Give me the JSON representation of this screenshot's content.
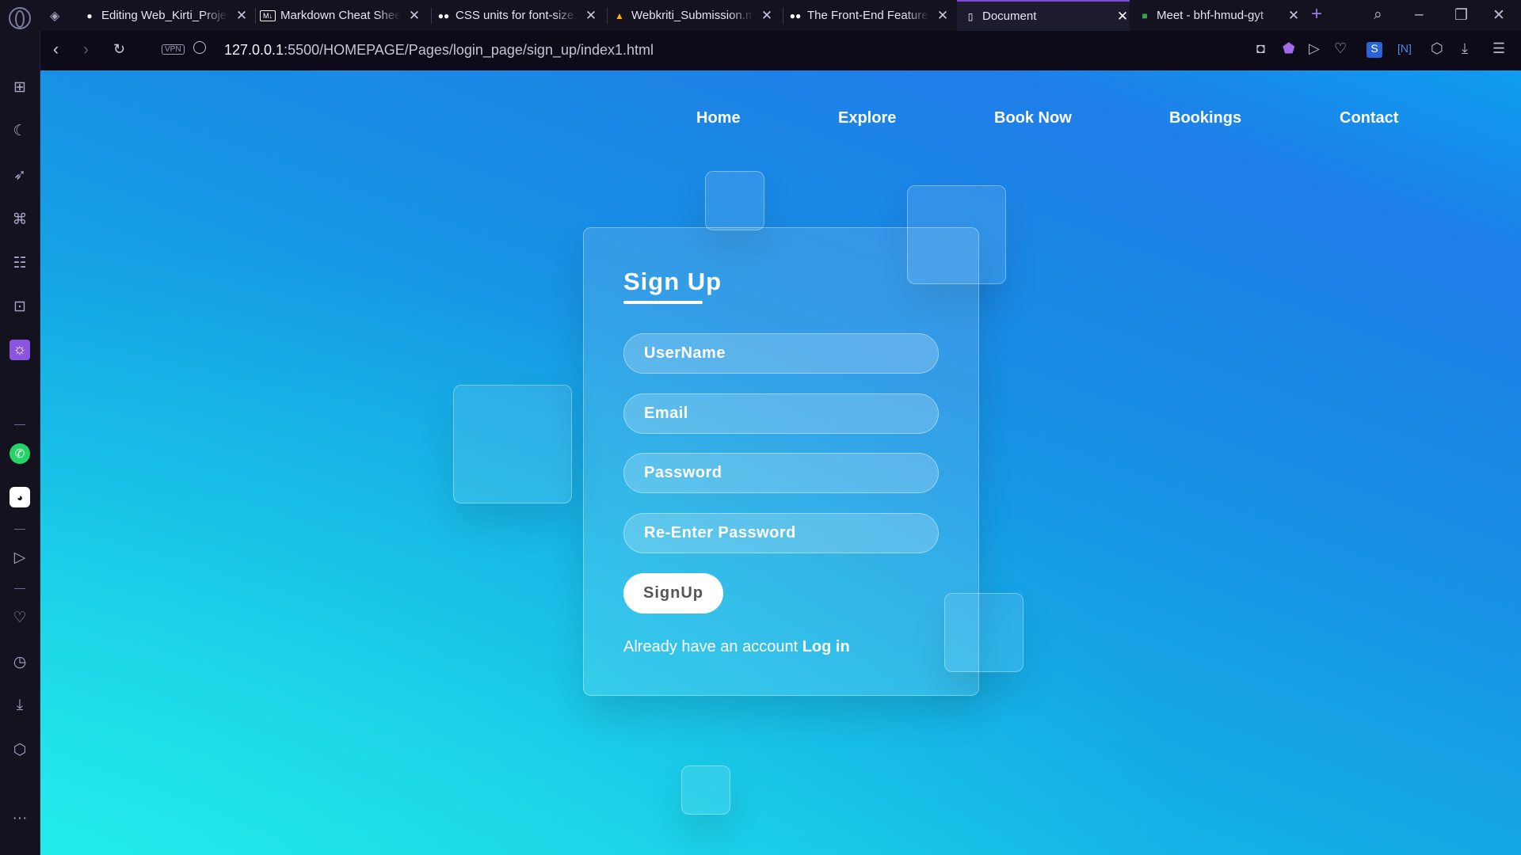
{
  "browser": {
    "tabs": [
      {
        "title": "Editing Web_Kirti_Proje",
        "favicon": "github-icon"
      },
      {
        "title": "Markdown Cheat Sheet",
        "favicon": "markdown-icon"
      },
      {
        "title": "CSS units for font-size:",
        "favicon": "medium-icon"
      },
      {
        "title": "Webkriti_Submission.m",
        "favicon": "drive-icon"
      },
      {
        "title": "The Front-End Features",
        "favicon": "medium-icon"
      },
      {
        "title": "Document",
        "favicon": "document-icon"
      },
      {
        "title": "Meet - bhf-hmud-gyt",
        "favicon": "meet-icon"
      }
    ],
    "active_tab": 5,
    "vpn_label": "VPN",
    "url_host": "127.0.0.1",
    "url_path": ":5500/HOMEPAGE/Pages/login_page/sign_up/index1.html"
  },
  "page": {
    "nav": [
      "Home",
      "Explore",
      "Book Now",
      "Bookings",
      "Contact"
    ],
    "signup": {
      "title": "Sign Up",
      "fields": [
        {
          "placeholder": "UserName"
        },
        {
          "placeholder": "Email"
        },
        {
          "placeholder": "Password"
        },
        {
          "placeholder": "Re-Enter Password"
        }
      ],
      "button": "SignUp",
      "footer_text": "Already have an account",
      "footer_link": "Log in"
    }
  },
  "colors": {
    "accent": "#8a53e0",
    "bg_gradient_top": "#1f7ee8",
    "bg_gradient_bottom": "#1de6e8"
  }
}
